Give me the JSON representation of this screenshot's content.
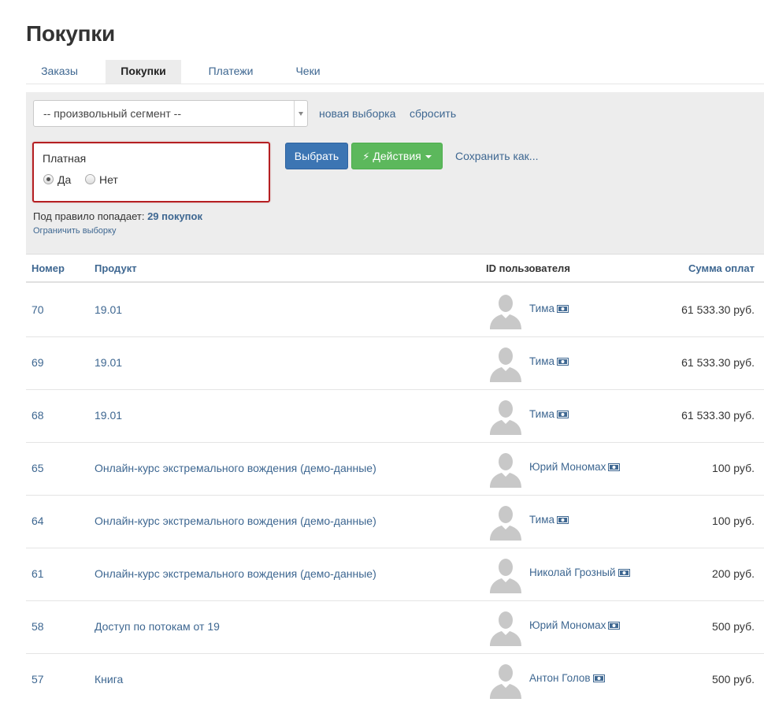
{
  "page": {
    "title": "Покупки"
  },
  "tabs": [
    {
      "label": "Заказы",
      "active": false
    },
    {
      "label": "Покупки",
      "active": true
    },
    {
      "label": "Платежи",
      "active": false
    },
    {
      "label": "Чеки",
      "active": false
    }
  ],
  "filter": {
    "segment_value": "-- произвольный сегмент --",
    "new_selection_label": "новая выборка",
    "reset_label": "сбросить",
    "rule": {
      "title": "Платная",
      "options": [
        {
          "label": "Да",
          "checked": true
        },
        {
          "label": "Нет",
          "checked": false
        }
      ]
    },
    "select_button": "Выбрать",
    "actions_button": "Действия",
    "save_as_label": "Сохранить как...",
    "rule_count_prefix": "Под правило попадает:",
    "rule_count_value": "29 покупок",
    "limit_label": "Ограничить выборку"
  },
  "table": {
    "columns": [
      "Номер",
      "Продукт",
      "ID пользователя",
      "Сумма оплат"
    ],
    "rows": [
      {
        "number": "70",
        "product": "19.01",
        "user": "Тима",
        "amount": "61 533.30 руб."
      },
      {
        "number": "69",
        "product": "19.01",
        "user": "Тима",
        "amount": "61 533.30 руб."
      },
      {
        "number": "68",
        "product": "19.01",
        "user": "Тима",
        "amount": "61 533.30 руб."
      },
      {
        "number": "65",
        "product": "Онлайн-курс экстремального вождения (демо-данные)",
        "user": "Юрий Мономах",
        "amount": "100 руб."
      },
      {
        "number": "64",
        "product": "Онлайн-курс экстремального вождения (демо-данные)",
        "user": "Тима",
        "amount": "100 руб."
      },
      {
        "number": "61",
        "product": "Онлайн-курс экстремального вождения (демо-данные)",
        "user": "Николай Грозный",
        "amount": "200 руб."
      },
      {
        "number": "58",
        "product": "Доступ по потокам от 19",
        "user": "Юрий Мономах",
        "amount": "500 руб."
      },
      {
        "number": "57",
        "product": "Книга",
        "user": "Антон Голов",
        "amount": "500 руб."
      }
    ]
  },
  "colors": {
    "link": "#3e6791",
    "primary_button": "#3c75b3",
    "success_button": "#5cb85c",
    "highlight_border": "#b51f22",
    "panel_bg": "#ededed"
  },
  "icons": {
    "avatar": "person-silhouette-icon",
    "user_card": "money-card-icon",
    "actions": "bolt-icon"
  }
}
